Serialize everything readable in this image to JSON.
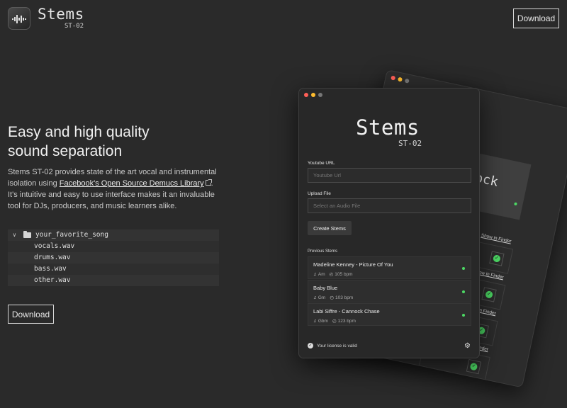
{
  "header": {
    "brand_name": "Stems",
    "brand_sub": "ST-02",
    "download_label": "Download"
  },
  "hero": {
    "headline_line1": "Easy and high quality",
    "headline_line2": "sound separation",
    "desc_before": "Stems ST-02 provides state of the art vocal and instrumental isolation using ",
    "desc_link": "Facebook's Open Source Demucs Library",
    "desc_after": ". It's intuitive and easy to use interface makes it an invaluable tool for DJs, producers, and music learners alike.",
    "download_label": "Download"
  },
  "tree": {
    "root": "your_favorite_song",
    "files": [
      "vocals.wav",
      "drums.wav",
      "bass.wav",
      "other.wav"
    ]
  },
  "app": {
    "title": "Stems",
    "subtitle": "ST-02",
    "youtube_label": "Youtube URL",
    "youtube_placeholder": "Youtube Url",
    "upload_label": "Upload File",
    "upload_placeholder": "Select an Audio File",
    "create_label": "Create Stems",
    "previous_label": "Previous Stems",
    "stems": [
      {
        "title": "Madeline Kenney - Picture Of You",
        "key": "Am",
        "bpm": "105 bpm"
      },
      {
        "title": "Baby Blue",
        "key": "Gm",
        "bpm": "103 bpm"
      },
      {
        "title": "Labi Siffre - Cannock Chase",
        "key": "Gbm",
        "bpm": "123 bpm"
      }
    ],
    "license_text": "Your license is valid"
  },
  "back_window": {
    "title_fragment": "nnock",
    "show_in_finder": "Show in Finder"
  },
  "colors": {
    "background": "#2a2a2a",
    "status_green": "#4cd964",
    "close": "#ff5f57",
    "minimize": "#febc2e"
  }
}
